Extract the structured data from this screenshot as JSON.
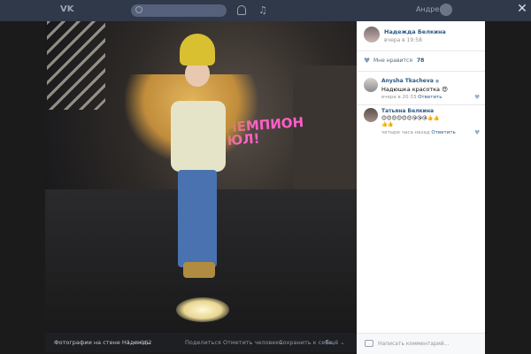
{
  "header": {
    "logo_text": "VK",
    "user_name": "Андрей",
    "close_symbol": "✕",
    "icons": [
      "vk-logo-icon",
      "search-icon",
      "bell-icon",
      "music-icon",
      "close-icon"
    ]
  },
  "photo": {
    "neon_text_line1": "ЧЕМПИОН",
    "neon_text_line2": "ЮЛ!"
  },
  "photo_bar": {
    "album_title": "Фотографии на стене Надежды",
    "counter": "1 из 162",
    "share": "Поделиться",
    "tag_person": "Отметить человека",
    "save": "Сохранить к себе",
    "more": "Ещё ⌄"
  },
  "author": {
    "name": "Надежда Белкина",
    "time": "вчера в 19:58"
  },
  "likes": {
    "label": "Мне нравится",
    "count": "78"
  },
  "comments": [
    {
      "name": "Anysha Tkacheva",
      "text": "Надюшка красотка 😍",
      "time": "вчера в 20:33",
      "reply": "Ответить"
    },
    {
      "name": "Татьяна Белкина",
      "text": "😊😊😊😊😊😊😘😘😘👍👍",
      "text2": "👍👍",
      "time": "четыре часа назад",
      "reply": "Ответить"
    }
  ],
  "compose": {
    "placeholder": "Написать комментарий..."
  },
  "colors": {
    "link": "#2a5885",
    "muted": "#939393",
    "overlay": "#1b1b1c",
    "panel": "#ffffff"
  }
}
